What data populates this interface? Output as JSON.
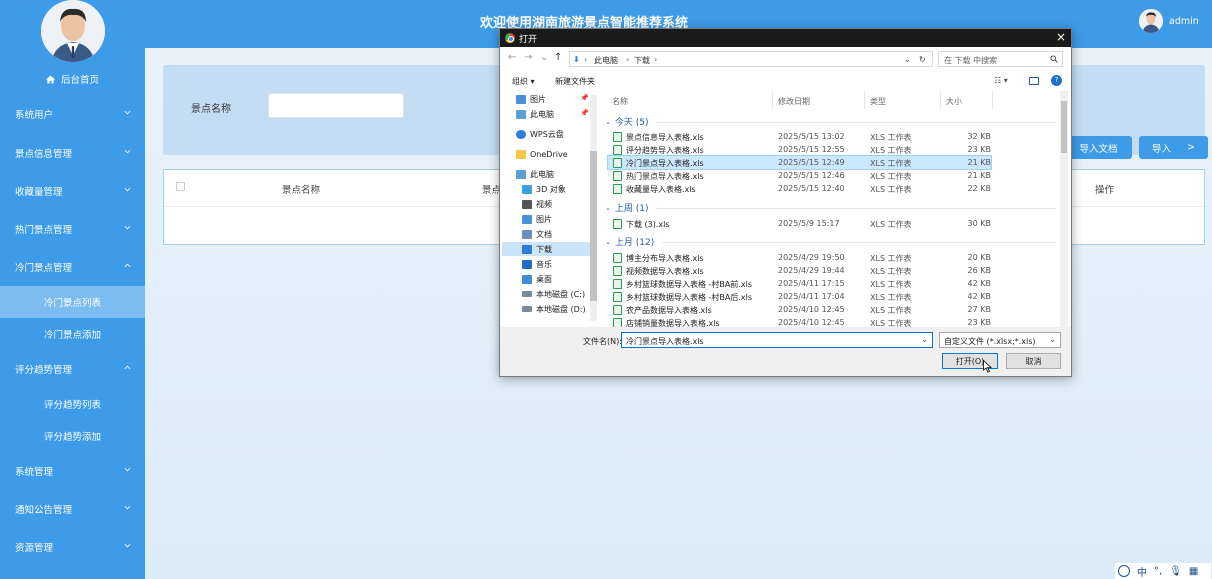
{
  "header": {
    "title": "欢迎使用湖南旅游景点智能推荐系统",
    "username": "admin"
  },
  "sidebar": {
    "home": "后台首页",
    "items": [
      {
        "label": "系统用户"
      },
      {
        "label": "景点信息管理"
      },
      {
        "label": "收藏量管理"
      },
      {
        "label": "热门景点管理"
      },
      {
        "label": "冷门景点管理"
      },
      {
        "label": "评分趋势管理"
      },
      {
        "label": "系统管理"
      },
      {
        "label": "通知公告管理"
      },
      {
        "label": "资源管理"
      }
    ],
    "subitems_cold": [
      "冷门景点列表",
      "冷门景点添加"
    ],
    "subitems_score": [
      "评分趋势列表",
      "评分趋势添加"
    ]
  },
  "search": {
    "label": "景点名称",
    "value": ""
  },
  "buttons": {
    "import_doc": "导入文档",
    "import": "导入",
    "import_arrow": ">"
  },
  "table": {
    "columns": [
      "景点名称",
      "景点",
      "操作"
    ]
  },
  "dialog": {
    "title": "打开",
    "close": "×",
    "path": [
      "此电脑",
      "下载"
    ],
    "search_placeholder": "在 下载 中搜索",
    "toolbar": {
      "organize": "组织 ▾",
      "new_folder": "新建文件夹"
    },
    "tree": [
      {
        "label": "图片",
        "color": "#4a90d9"
      },
      {
        "label": "此电脑",
        "color": "#5a9fd4"
      },
      {
        "label": "WPS云盘",
        "color": "#2f7fd8"
      },
      {
        "label": "OneDrive",
        "color": "#f3c646"
      },
      {
        "label": "此电脑",
        "color": "#5a9fd4"
      },
      {
        "label": "3D 对象",
        "color": "#3aa0e0"
      },
      {
        "label": "视频",
        "color": "#555555"
      },
      {
        "label": "图片",
        "color": "#4a90d9"
      },
      {
        "label": "文档",
        "color": "#6a8fb8"
      },
      {
        "label": "下载",
        "color": "#2e7bd6"
      },
      {
        "label": "音乐",
        "color": "#1e6fc9"
      },
      {
        "label": "桌面",
        "color": "#3b8fd9"
      },
      {
        "label": "本地磁盘 (C:)",
        "color": "#7a8a99"
      },
      {
        "label": "本地磁盘 (D:)",
        "color": "#7a8a99"
      }
    ],
    "columns": {
      "name": "名称",
      "date": "修改日期",
      "type": "类型",
      "size": "大小"
    },
    "groups": [
      {
        "label": "今天 (5)",
        "files": [
          {
            "name": "景点信息导入表格.xls",
            "date": "2025/5/15 13:02",
            "type": "XLS 工作表",
            "size": "32 KB"
          },
          {
            "name": "评分趋势导入表格.xls",
            "date": "2025/5/15 12:55",
            "type": "XLS 工作表",
            "size": "23 KB"
          },
          {
            "name": "冷门景点导入表格.xls",
            "date": "2025/5/15 12:49",
            "type": "XLS 工作表",
            "size": "21 KB"
          },
          {
            "name": "热门景点导入表格.xls",
            "date": "2025/5/15 12:46",
            "type": "XLS 工作表",
            "size": "21 KB"
          },
          {
            "name": "收藏量导入表格.xls",
            "date": "2025/5/15 12:40",
            "type": "XLS 工作表",
            "size": "22 KB"
          }
        ]
      },
      {
        "label": "上周 (1)",
        "files": [
          {
            "name": "下载 (3).xls",
            "date": "2025/5/9 15:17",
            "type": "XLS 工作表",
            "size": "30 KB"
          }
        ]
      },
      {
        "label": "上月 (12)",
        "files": [
          {
            "name": "博主分布导入表格.xls",
            "date": "2025/4/29 19:50",
            "type": "XLS 工作表",
            "size": "20 KB"
          },
          {
            "name": "视频数据导入表格.xls",
            "date": "2025/4/29 19:44",
            "type": "XLS 工作表",
            "size": "26 KB"
          },
          {
            "name": "乡村篮球数据导入表格 -村BA前.xls",
            "date": "2025/4/11 17:15",
            "type": "XLS 工作表",
            "size": "42 KB"
          },
          {
            "name": "乡村篮球数据导入表格 -村BA后.xls",
            "date": "2025/4/11 17:04",
            "type": "XLS 工作表",
            "size": "42 KB"
          },
          {
            "name": "农产品数据导入表格.xls",
            "date": "2025/4/10 12:45",
            "type": "XLS 工作表",
            "size": "27 KB"
          },
          {
            "name": "店铺销量数据导入表格.xls",
            "date": "2025/4/10 12:45",
            "type": "XLS 工作表",
            "size": "23 KB"
          }
        ]
      }
    ],
    "filename_label": "文件名(N):",
    "filename_value": "冷门景点导入表格.xls",
    "filetype": "自定义文件 (*.xlsx;*.xls)",
    "open_btn": "打开(O)",
    "cancel_btn": "取消"
  },
  "ime": {
    "lang": "中",
    "punct": "°,"
  }
}
